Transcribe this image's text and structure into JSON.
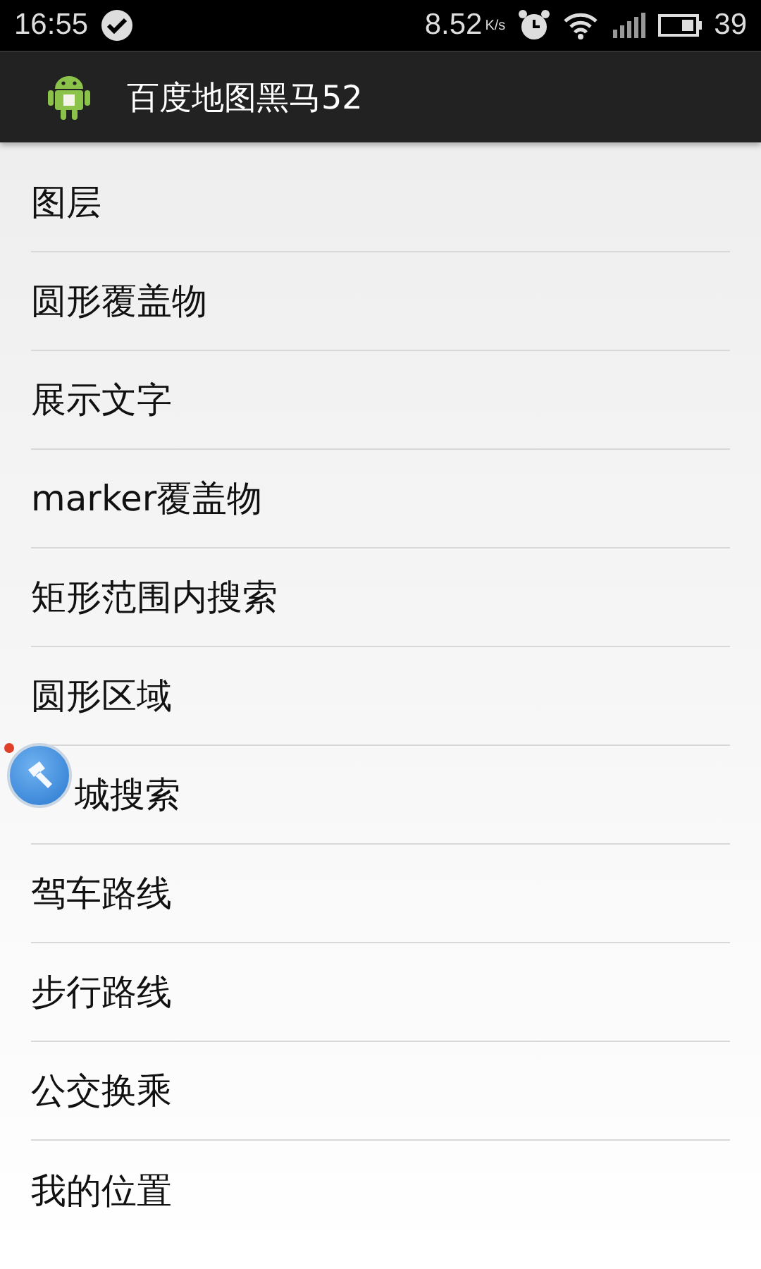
{
  "status_bar": {
    "time": "16:55",
    "speed": "8.52",
    "speed_unit": "K/s",
    "battery": "39"
  },
  "app_bar": {
    "title": "百度地图黑马52"
  },
  "menu_items": [
    {
      "label": "图层"
    },
    {
      "label": "圆形覆盖物"
    },
    {
      "label": "展示文字"
    },
    {
      "label": "marker覆盖物"
    },
    {
      "label": "矩形范围内搜索"
    },
    {
      "label": "圆形区域"
    },
    {
      "label": "城搜索",
      "floating_ball": true
    },
    {
      "label": "驾车路线"
    },
    {
      "label": "步行路线"
    },
    {
      "label": "公交换乘"
    },
    {
      "label": "我的位置"
    }
  ]
}
